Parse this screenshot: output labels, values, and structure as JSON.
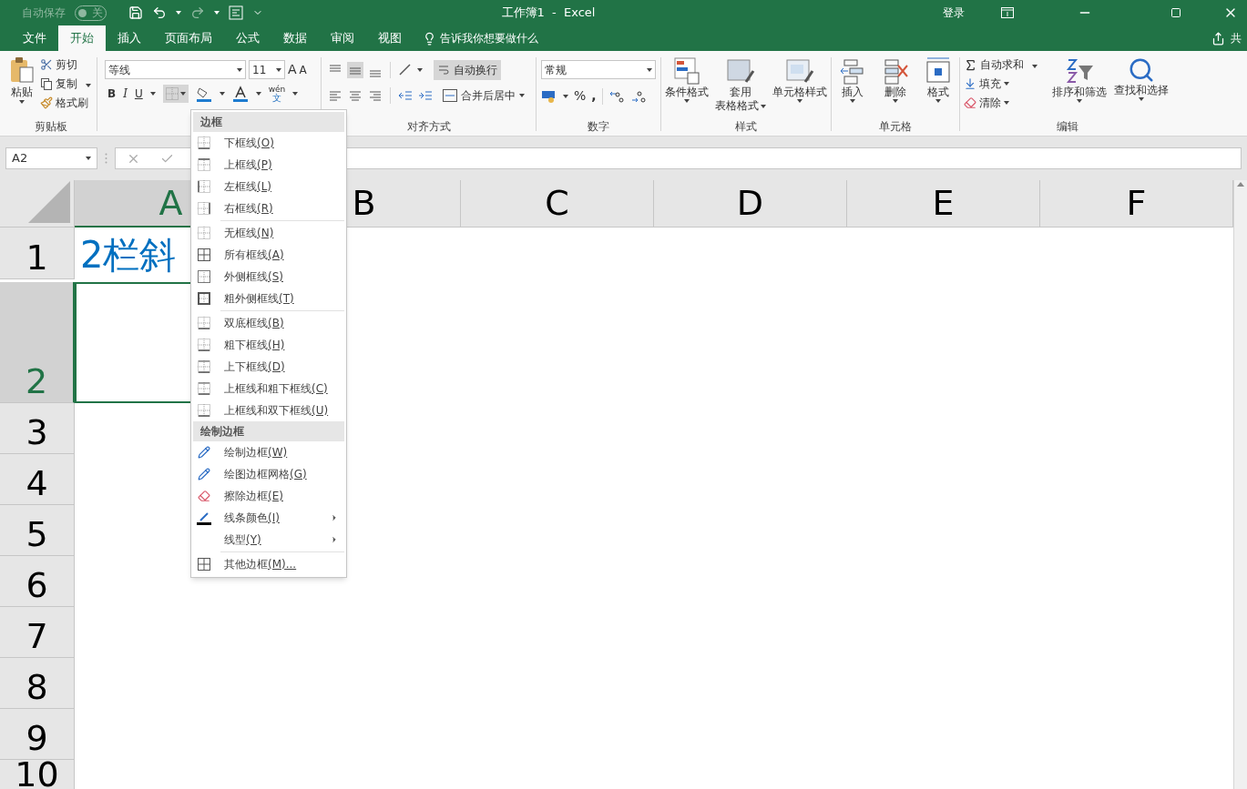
{
  "title_bar": {
    "autosave_label": "自动保存",
    "autosave_toggle": {
      "label": "关",
      "on": false
    },
    "title": "工作簿1  -  Excel",
    "sign_in": "登录"
  },
  "tabs": [
    {
      "label": "文件",
      "selected": false
    },
    {
      "label": "开始",
      "selected": true
    },
    {
      "label": "插入",
      "selected": false
    },
    {
      "label": "页面布局",
      "selected": false
    },
    {
      "label": "公式",
      "selected": false
    },
    {
      "label": "数据",
      "selected": false
    },
    {
      "label": "审阅",
      "selected": false
    },
    {
      "label": "视图",
      "selected": false
    }
  ],
  "tell_me": "告诉我你想要做什么",
  "share": "共",
  "ribbon": {
    "clipboard": {
      "paste": "粘贴",
      "cut": "剪切",
      "copy": "复制",
      "format_painter": "格式刷",
      "label": "剪贴板"
    },
    "font": {
      "name": "等线",
      "size": "11",
      "grow": "A",
      "shrink": "A",
      "bold": "B",
      "italic": "I",
      "underline": "U",
      "phonetic_top": "wén",
      "phonetic_bottom": "文"
    },
    "alignment": {
      "wrap": "自动换行",
      "merge": "合并后居中",
      "label": "对齐方式"
    },
    "number": {
      "format": "常规",
      "percent": "%",
      "comma": ",",
      "label": "数字"
    },
    "styles": {
      "conditional": "条件格式",
      "table_1": "套用",
      "table_2": "表格格式",
      "cell_styles": "单元格样式",
      "label": "样式"
    },
    "cells": {
      "insert": "插入",
      "delete": "删除",
      "format": "格式",
      "label": "单元格"
    },
    "editing": {
      "autosum": "自动求和",
      "fill": "填充",
      "clear": "清除",
      "sort": "排序和筛选",
      "find": "查找和选择",
      "label": "编辑"
    }
  },
  "name_box": "A2",
  "sheet": {
    "columns": [
      {
        "label": "A",
        "selected": true
      },
      {
        "label": "B",
        "selected": false
      },
      {
        "label": "C",
        "selected": false
      },
      {
        "label": "D",
        "selected": false
      },
      {
        "label": "E",
        "selected": false
      },
      {
        "label": "F",
        "selected": false
      }
    ],
    "rows": [
      {
        "label": "1",
        "selected": false
      },
      {
        "label": "2",
        "selected": true
      },
      {
        "label": "3",
        "selected": false
      },
      {
        "label": "4",
        "selected": false
      },
      {
        "label": "5",
        "selected": false
      },
      {
        "label": "6",
        "selected": false
      },
      {
        "label": "7",
        "selected": false
      },
      {
        "label": "8",
        "selected": false
      },
      {
        "label": "9",
        "selected": false
      },
      {
        "label": "10",
        "selected": false
      }
    ],
    "a1": "2栏斜"
  },
  "border_menu": [
    {
      "kind": "header",
      "label": "边框"
    },
    {
      "kind": "bottom",
      "label": "下框线",
      "accel": "(O)"
    },
    {
      "kind": "top",
      "label": "上框线",
      "accel": "(P)"
    },
    {
      "kind": "left",
      "label": "左框线",
      "accel": "(L)"
    },
    {
      "kind": "right",
      "label": "右框线",
      "accel": "(R)"
    },
    {
      "kind": "separator"
    },
    {
      "kind": "none",
      "label": "无框线",
      "accel": "(N)"
    },
    {
      "kind": "all",
      "label": "所有框线",
      "accel": "(A)"
    },
    {
      "kind": "outside",
      "label": "外侧框线",
      "accel": "(S)"
    },
    {
      "kind": "thick",
      "label": "粗外侧框线",
      "accel": "(T)"
    },
    {
      "kind": "separator"
    },
    {
      "kind": "bottom",
      "label": "双底框线",
      "accel": "(B)"
    },
    {
      "kind": "bottom",
      "label": "粗下框线",
      "accel": "(H)"
    },
    {
      "kind": "topbottom",
      "label": "上下框线",
      "accel": "(D)"
    },
    {
      "kind": "topbottom",
      "label": "上框线和粗下框线",
      "accel": "(C)"
    },
    {
      "kind": "bottom",
      "label": "上框线和双下框线",
      "accel": "(U)"
    },
    {
      "kind": "header",
      "label": "绘制边框"
    },
    {
      "kind": "pen",
      "label": "绘制边框",
      "accel": "(W)"
    },
    {
      "kind": "gridpen",
      "label": "绘图边框网格",
      "accel": "(G)"
    },
    {
      "kind": "eraser",
      "label": "擦除边框",
      "accel": "(E)"
    },
    {
      "kind": "color",
      "label": "线条颜色",
      "accel": "(I)",
      "submenu": true
    },
    {
      "kind": "plain",
      "label": "线型",
      "accel": "(Y)",
      "submenu": true
    },
    {
      "kind": "separator"
    },
    {
      "kind": "all",
      "label": "其他边框",
      "accel": "(M)..."
    }
  ]
}
